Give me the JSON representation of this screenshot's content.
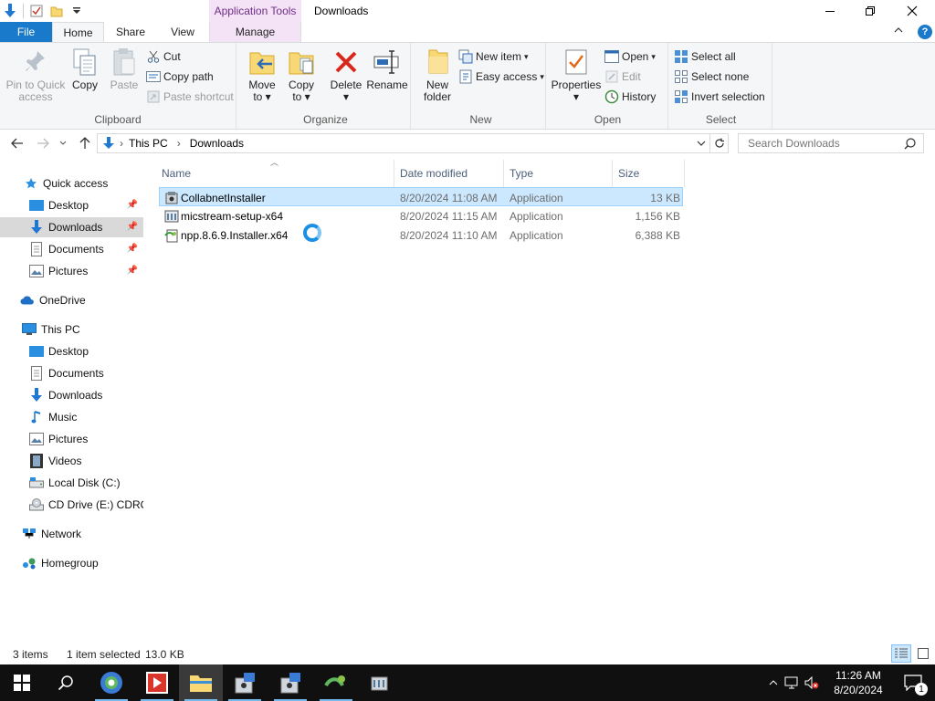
{
  "window": {
    "title": "Downloads",
    "contextual_tab_header": "Application Tools"
  },
  "tabs": {
    "file": "File",
    "home": "Home",
    "share": "Share",
    "view": "View",
    "manage": "Manage"
  },
  "ribbon": {
    "clipboard": {
      "label": "Clipboard",
      "pin_line1": "Pin to Quick",
      "pin_line2": "access",
      "copy": "Copy",
      "paste": "Paste",
      "cut": "Cut",
      "copy_path": "Copy path",
      "paste_shortcut": "Paste shortcut"
    },
    "organize": {
      "label": "Organize",
      "move_line1": "Move",
      "move_line2": "to",
      "copy_line1": "Copy",
      "copy_line2": "to",
      "delete": "Delete",
      "rename": "Rename"
    },
    "new": {
      "label": "New",
      "new_folder_line1": "New",
      "new_folder_line2": "folder",
      "new_item": "New item",
      "easy_access": "Easy access"
    },
    "open": {
      "label": "Open",
      "properties": "Properties",
      "open": "Open",
      "edit": "Edit",
      "history": "History"
    },
    "select": {
      "label": "Select",
      "select_all": "Select all",
      "select_none": "Select none",
      "invert_selection": "Invert selection"
    }
  },
  "address": {
    "crumbs": [
      "This PC",
      "Downloads"
    ],
    "search_placeholder": "Search Downloads"
  },
  "nav": {
    "quick_access": "Quick access",
    "qa_items": [
      "Desktop",
      "Downloads",
      "Documents",
      "Pictures"
    ],
    "onedrive": "OneDrive",
    "this_pc": "This PC",
    "pc_items": [
      "Desktop",
      "Documents",
      "Downloads",
      "Music",
      "Pictures",
      "Videos",
      "Local Disk (C:)",
      "CD Drive (E:) CDROM"
    ],
    "network": "Network",
    "homegroup": "Homegroup"
  },
  "columns": {
    "name": "Name",
    "date_modified": "Date modified",
    "type": "Type",
    "size": "Size"
  },
  "files": [
    {
      "name": "CollabnetInstaller",
      "date": "8/20/2024 11:08 AM",
      "type": "Application",
      "size": "13 KB",
      "selected": true
    },
    {
      "name": "micstream-setup-x64",
      "date": "8/20/2024 11:15 AM",
      "type": "Application",
      "size": "1,156 KB",
      "selected": false
    },
    {
      "name": "npp.8.6.9.Installer.x64",
      "date": "8/20/2024 11:10 AM",
      "type": "Application",
      "size": "6,388 KB",
      "selected": false
    }
  ],
  "status": {
    "item_count": "3 items",
    "selection": "1 item selected",
    "selection_size": "13.0 KB"
  },
  "taskbar": {
    "time": "11:26 AM",
    "date": "8/20/2024",
    "notification_count": "1"
  },
  "colors": {
    "accent": "#1979ca",
    "selection_bg": "#cce8ff",
    "selection_border": "#99d1ff",
    "context_tab": "#f4e3f7",
    "taskbar": "#101010"
  }
}
